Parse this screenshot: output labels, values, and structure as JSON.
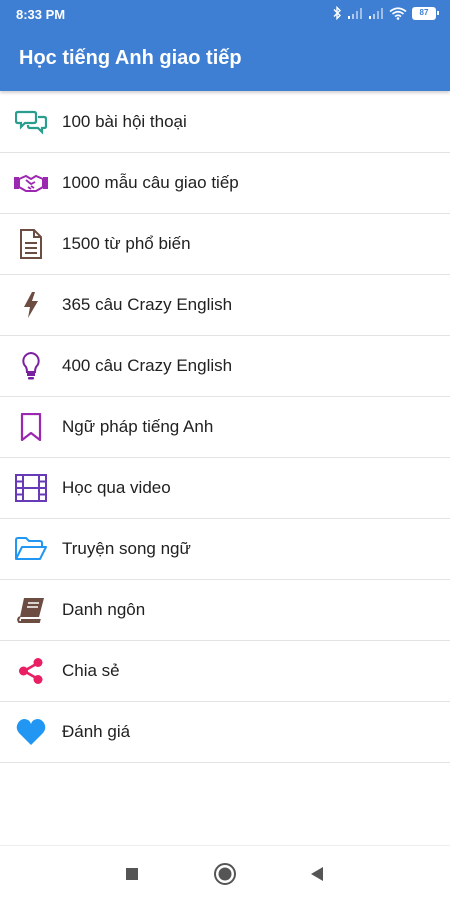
{
  "status_bar": {
    "time": "8:33 PM",
    "battery": "87"
  },
  "app_bar": {
    "title": "Học tiếng Anh giao tiếp",
    "color": "#3f7fd3"
  },
  "menu": {
    "items": [
      {
        "label": "100 bài hội thoại",
        "icon": "chat-bubbles-icon",
        "color": "#2a9d8f"
      },
      {
        "label": "1000 mẫu câu giao tiếp",
        "icon": "handshake-icon",
        "color": "#9c27b0"
      },
      {
        "label": "1500 từ phổ biến",
        "icon": "document-icon",
        "color": "#6d4c41"
      },
      {
        "label": "365 câu Crazy English",
        "icon": "lightning-icon",
        "color": "#6d4c41"
      },
      {
        "label": "400 câu Crazy English",
        "icon": "lightbulb-icon",
        "color": "#7b1fa2"
      },
      {
        "label": "Ngữ pháp tiếng Anh",
        "icon": "bookmark-icon",
        "color": "#9c27b0"
      },
      {
        "label": "Học qua video",
        "icon": "film-icon",
        "color": "#673ab7"
      },
      {
        "label": "Truyện song ngữ",
        "icon": "folder-icon",
        "color": "#2196f3"
      },
      {
        "label": "Danh ngôn",
        "icon": "book-icon",
        "color": "#6d4c41"
      },
      {
        "label": "Chia sẻ",
        "icon": "share-icon",
        "color": "#e91e63"
      },
      {
        "label": "Đánh giá",
        "icon": "heart-icon",
        "color": "#2196f3"
      }
    ]
  }
}
